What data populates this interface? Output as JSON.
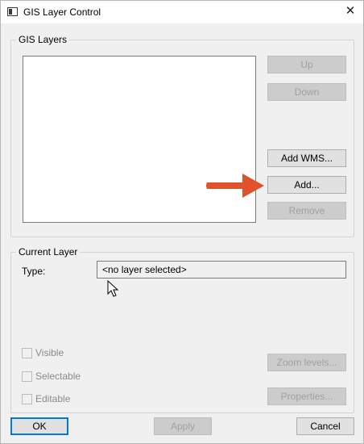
{
  "window": {
    "title": "GIS Layer Control",
    "close_glyph": "✕"
  },
  "gis_layers": {
    "group_label": "GIS Layers",
    "items": [],
    "buttons": {
      "up": "Up",
      "down": "Down",
      "add_wms": "Add WMS...",
      "add": "Add...",
      "remove": "Remove"
    }
  },
  "current_layer": {
    "group_label": "Current Layer",
    "type_label": "Type:",
    "type_value": "<no layer selected>",
    "checkboxes": {
      "visible": "Visible",
      "selectable": "Selectable",
      "editable": "Editable"
    },
    "buttons": {
      "zoom_levels": "Zoom levels...",
      "properties": "Properties..."
    }
  },
  "footer": {
    "ok": "OK",
    "apply": "Apply",
    "cancel": "Cancel"
  },
  "annotation": {
    "arrow_color": "#e0522a",
    "arrow_icon": "arrow-right-icon"
  },
  "colors": {
    "default_button_border": "#0078d7",
    "disabled_text": "#a0a0a0"
  }
}
